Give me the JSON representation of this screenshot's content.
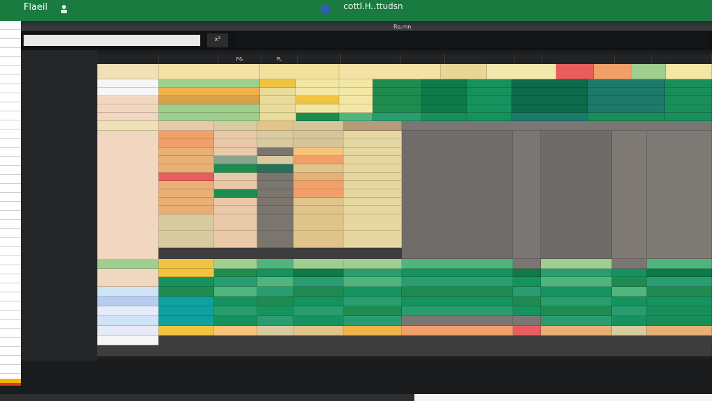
{
  "titlebar": {
    "app_title": "Flaeil",
    "doc_title": "cottl.H..ttudsn",
    "menu_items": [
      "",
      "",
      "",
      "",
      "",
      "",
      "",
      "",
      "",
      ""
    ],
    "right_items": [
      "",
      "",
      "",
      ""
    ]
  },
  "formula_bar": {
    "name_box": "",
    "fx_label": "x²",
    "cell_ref": "Ro.mn"
  },
  "columns": [
    "",
    "",
    "P&",
    "PL",
    "",
    "",
    "",
    "",
    "",
    "",
    "",
    ""
  ],
  "left_panel": {
    "rows": [
      "",
      "",
      "",
      "",
      "",
      "",
      "",
      "",
      "",
      "",
      "",
      "",
      "",
      "",
      "",
      "",
      "",
      "",
      "",
      "",
      "",
      "",
      "",
      "",
      "",
      "",
      "",
      "",
      ""
    ]
  },
  "grid": {
    "cells": [
      {
        "text": "",
        "color": "#d9cba0"
      },
      {
        "text": "",
        "color": "#e9df94"
      },
      {
        "text": "",
        "color": "#f3e8ac"
      },
      {
        "text": "",
        "color": "#e8d890"
      },
      {
        "text": "",
        "color": "#f0b24a"
      },
      {
        "text": "",
        "color": "#e85d5d"
      },
      {
        "text": "",
        "color": "#f2a06a"
      },
      {
        "text": "",
        "color": "#9fcf8f"
      },
      {
        "text": "",
        "color": "#f3e7a6"
      },
      {
        "text": "",
        "color": "#e9db9a"
      },
      {
        "text": "",
        "color": "#1e8c4e"
      },
      {
        "text": "",
        "color": "#4fb57c"
      },
      {
        "text": "",
        "color": "#0d7a48"
      },
      {
        "text": "",
        "color": "#16925e"
      },
      {
        "text": "",
        "color": "#2a9d70"
      },
      {
        "text": "",
        "color": "#f6c57a"
      },
      {
        "text": "",
        "color": "#f1d7bf"
      },
      {
        "text": "",
        "color": "#cfe3f6"
      },
      {
        "text": "",
        "color": "#b6ccf0"
      },
      {
        "text": "",
        "color": "#e6ecf7"
      }
    ]
  },
  "status_bar": {
    "text": ""
  },
  "colors": {
    "ribbon_green": "#197b3f",
    "dark_bg": "#1c1d1f",
    "panel": "#252628"
  }
}
